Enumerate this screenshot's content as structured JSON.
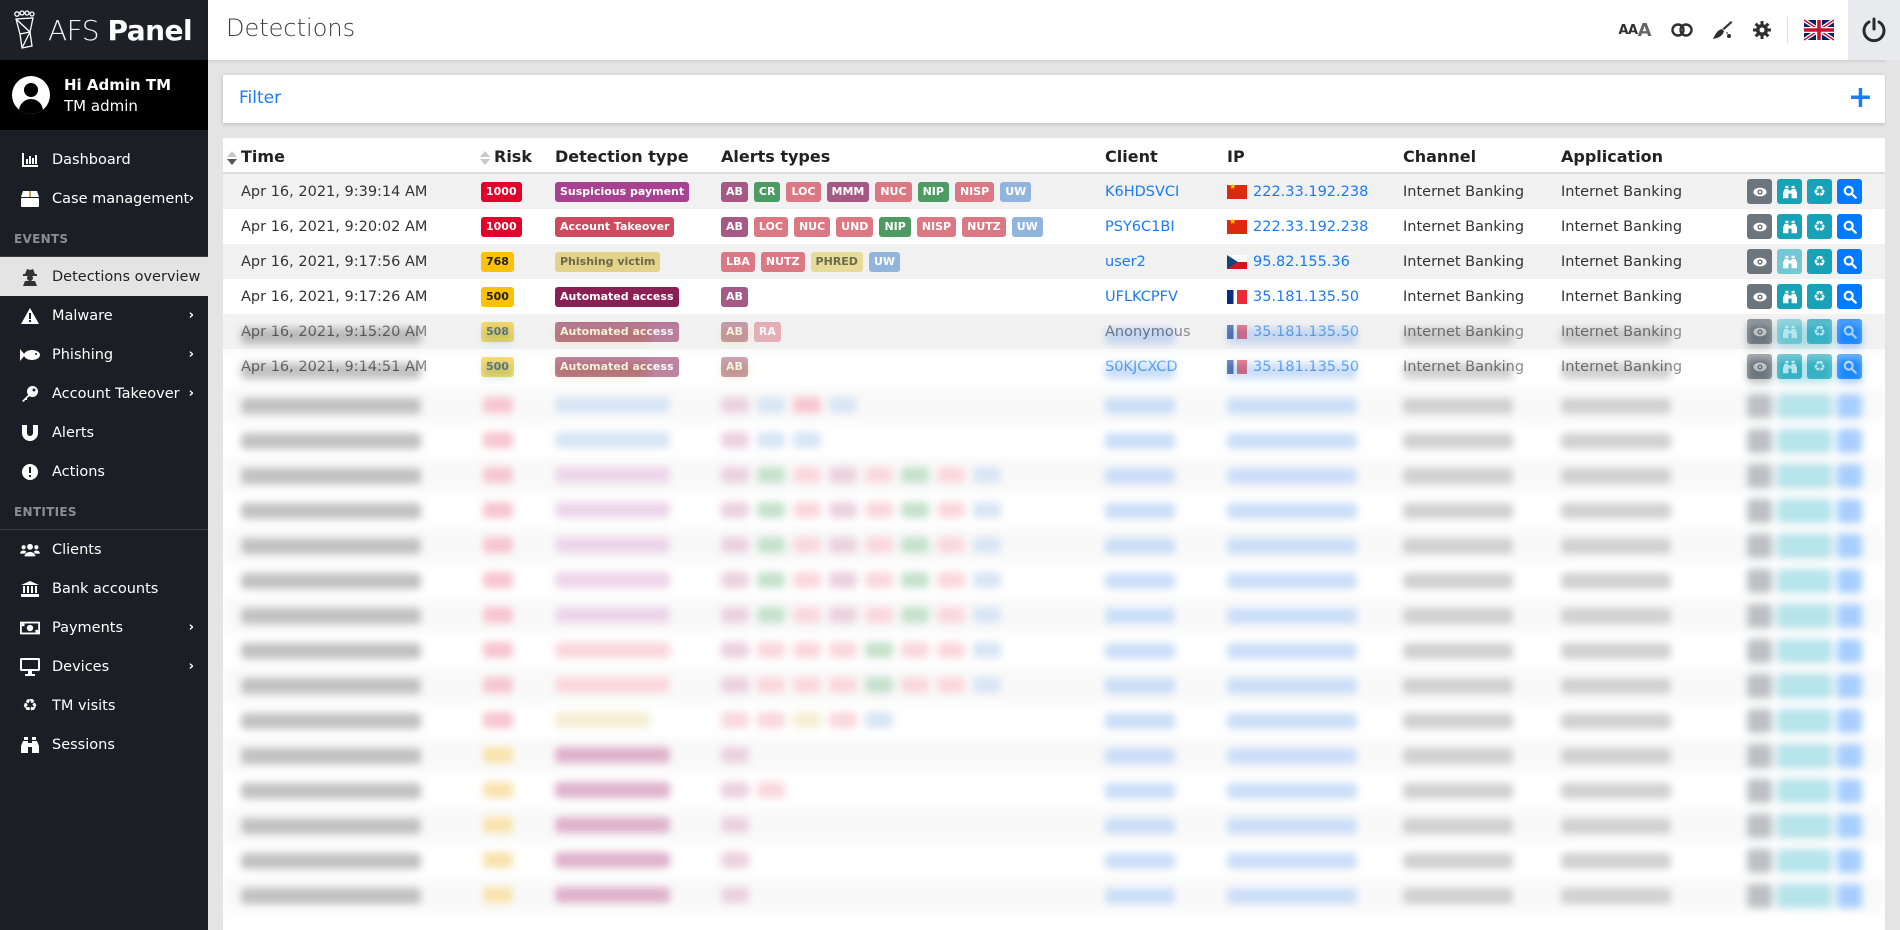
{
  "app": {
    "logo_light": "AFS",
    "logo_bold": "Panel",
    "page_title": "Detections"
  },
  "user": {
    "greeting": "Hi Admin TM",
    "role": "TM admin"
  },
  "sidebar": {
    "top_items": [
      {
        "label": "Dashboard",
        "icon": "chart-bar-icon",
        "has_submenu": false
      },
      {
        "label": "Case management",
        "icon": "box-icon",
        "has_submenu": true
      }
    ],
    "sections": [
      {
        "label": "EVENTS",
        "items": [
          {
            "label": "Detections overview",
            "icon": "user-secret-icon",
            "active": true,
            "has_submenu": false
          },
          {
            "label": "Malware",
            "icon": "warning-icon",
            "has_submenu": true
          },
          {
            "label": "Phishing",
            "icon": "fish-icon",
            "has_submenu": true
          },
          {
            "label": "Account Takeover",
            "icon": "key-icon",
            "has_submenu": true
          },
          {
            "label": "Alerts",
            "icon": "magnet-icon",
            "has_submenu": false
          },
          {
            "label": "Actions",
            "icon": "exclamation-circle-icon",
            "has_submenu": false
          }
        ]
      },
      {
        "label": "ENTITIES",
        "items": [
          {
            "label": "Clients",
            "icon": "users-icon",
            "has_submenu": false
          },
          {
            "label": "Bank accounts",
            "icon": "bank-icon",
            "has_submenu": false
          },
          {
            "label": "Payments",
            "icon": "money-bill-icon",
            "has_submenu": true
          },
          {
            "label": "Devices",
            "icon": "desktop-icon",
            "has_submenu": true
          },
          {
            "label": "TM visits",
            "icon": "recycle-icon",
            "has_submenu": false
          },
          {
            "label": "Sessions",
            "icon": "binoculars-icon",
            "has_submenu": false
          }
        ]
      }
    ]
  },
  "topbar": {
    "icons": [
      "font-size-icon",
      "contrast-toggle-icon",
      "broom-icon",
      "gear-icon"
    ],
    "font_size_label": "AA",
    "font_size_big": "A",
    "language": "English (UK)",
    "logout_icon": "power-icon"
  },
  "filter": {
    "label": "Filter",
    "add_label": "+"
  },
  "table": {
    "columns": [
      "Time",
      "Risk",
      "Detection type",
      "Alerts types",
      "Client",
      "IP",
      "Channel",
      "Application"
    ],
    "rows": [
      {
        "time": "Apr 16, 2021, 9:39:14 AM",
        "risk": "1000",
        "risk_color": "#e3002b",
        "detection_type": "Suspicious payment",
        "detection_color": "#a8418f",
        "detection_text_color": "#ffffff",
        "alerts": [
          {
            "label": "AB",
            "color": "#a45a84"
          },
          {
            "label": "CR",
            "color": "#4e9a63"
          },
          {
            "label": "LOC",
            "color": "#dc7884"
          },
          {
            "label": "MMM",
            "color": "#a45a84"
          },
          {
            "label": "NUC",
            "color": "#dc7884"
          },
          {
            "label": "NIP",
            "color": "#4e9a63"
          },
          {
            "label": "NISP",
            "color": "#dc7884"
          },
          {
            "label": "UW",
            "color": "#92b5dd"
          }
        ],
        "client": "K6HDSVCI",
        "client_link": true,
        "flag": "cn",
        "ip": "222.33.192.238",
        "channel": "Internet Banking",
        "application": "Internet Banking",
        "sessions_enabled": true
      },
      {
        "time": "Apr 16, 2021, 9:20:02 AM",
        "risk": "1000",
        "risk_color": "#e3002b",
        "detection_type": "Account Takeover",
        "detection_color": "#cd4a60",
        "detection_text_color": "#ffffff",
        "alerts": [
          {
            "label": "AB",
            "color": "#a45a84"
          },
          {
            "label": "LOC",
            "color": "#dc7884"
          },
          {
            "label": "NUC",
            "color": "#dc7884"
          },
          {
            "label": "UND",
            "color": "#dc7884"
          },
          {
            "label": "NIP",
            "color": "#4e9a63"
          },
          {
            "label": "NISP",
            "color": "#dc7884"
          },
          {
            "label": "NUTZ",
            "color": "#dc7884"
          },
          {
            "label": "UW",
            "color": "#92b5dd"
          }
        ],
        "client": "PSY6C1BI",
        "client_link": true,
        "flag": "cn",
        "ip": "222.33.192.238",
        "channel": "Internet Banking",
        "application": "Internet Banking",
        "sessions_enabled": true
      },
      {
        "time": "Apr 16, 2021, 9:17:56 AM",
        "risk": "768",
        "risk_color": "#ffc107",
        "detection_type": "Phishing victim",
        "detection_color": "#e2d28a",
        "detection_text_color": "#6b6b4a",
        "alerts": [
          {
            "label": "LBA",
            "color": "#dc7884"
          },
          {
            "label": "NUTZ",
            "color": "#dc7884"
          },
          {
            "label": "PHRED",
            "color": "#e8db9a",
            "text_color": "#6b6b4a"
          },
          {
            "label": "UW",
            "color": "#92b5dd"
          }
        ],
        "client": "user2",
        "client_link": true,
        "flag": "cz",
        "ip": "95.82.155.36",
        "channel": "Internet Banking",
        "application": "Internet Banking",
        "sessions_enabled": false
      },
      {
        "time": "Apr 16, 2021, 9:17:26 AM",
        "risk": "500",
        "risk_color": "#ffc107",
        "detection_type": "Automated access",
        "detection_color": "#8a1f56",
        "detection_text_color": "#ffffff",
        "alerts": [
          {
            "label": "AB",
            "color": "#a45a84"
          }
        ],
        "client": "UFLKCPFV",
        "client_link": true,
        "flag": "fr",
        "ip": "35.181.135.50",
        "channel": "Internet Banking",
        "application": "Internet Banking",
        "sessions_enabled": true
      },
      {
        "time": "Apr 16, 2021, 9:15:20 AM",
        "risk": "508",
        "risk_color": "#ffc107",
        "detection_type": "Automated access",
        "detection_color": "#8a1f56",
        "detection_text_color": "#ffffff",
        "alerts": [
          {
            "label": "AB",
            "color": "#a45a84"
          },
          {
            "label": "RA",
            "color": "#dc7884"
          }
        ],
        "client": "Anonymous",
        "client_link": false,
        "flag": "fr",
        "ip": "35.181.135.50",
        "channel": "Internet Banking",
        "application": "Internet Banking",
        "sessions_enabled": false
      },
      {
        "time": "Apr 16, 2021, 9:14:51 AM",
        "risk": "500",
        "risk_color": "#ffc107",
        "detection_type": "Automated access",
        "detection_color": "#8a1f56",
        "detection_text_color": "#ffffff",
        "alerts": [
          {
            "label": "AB",
            "color": "#a45a84"
          }
        ],
        "client": "S0KJCXCD",
        "client_link": true,
        "flag": "fr",
        "ip": "35.181.135.50",
        "channel": "Internet Banking",
        "application": "Internet Banking",
        "sessions_enabled": true
      }
    ],
    "row_actions": [
      {
        "name": "view-detail-button",
        "icon": "eye-icon",
        "color": "#6c757d"
      },
      {
        "name": "sessions-button",
        "icon": "binoculars-icon",
        "color": "#17a2b8",
        "disabled_color": "#74c7d4"
      },
      {
        "name": "tm-visits-button",
        "icon": "recycle-icon",
        "color": "#17a2b8"
      },
      {
        "name": "search-button",
        "icon": "search-icon",
        "color": "#007bff"
      }
    ]
  },
  "colors": {
    "accent": "#1a7bf2",
    "sidebar_bg": "#1c1e25",
    "page_bg": "#e4e4e4"
  }
}
